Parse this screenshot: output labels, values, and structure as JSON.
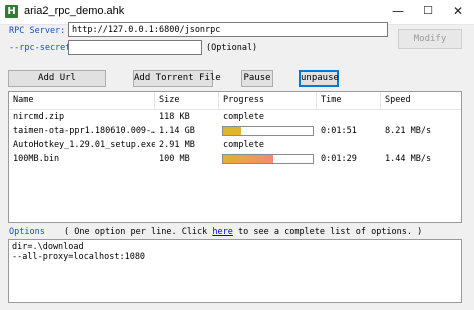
{
  "window": {
    "title": "aria2_rpc_demo.ahk",
    "icon_letter": "H",
    "minimize": "—",
    "maximize": "☐",
    "close": "✕"
  },
  "rpc": {
    "server_label": "RPC Server:",
    "server_value": "http://127.0.0.1:6800/jsonrpc",
    "secret_label": "--rpc-secret=",
    "secret_value": "",
    "optional_label": "(Optional)",
    "modify_label": "Modify"
  },
  "toolbar": {
    "add_url": "Add Url",
    "add_torrent": "Add Torrent File",
    "pause": "Pause",
    "unpause": "unpause"
  },
  "list": {
    "columns": [
      "Name",
      "Size",
      "Progress",
      "Time",
      "Speed"
    ],
    "rows": [
      {
        "name": "nircmd.zip",
        "size": "118 KB",
        "progress_text": "complete",
        "progress": null,
        "time": "",
        "speed": ""
      },
      {
        "name": "taimen-ota-ppr1.180610.009-…",
        "size": "1.14 GB",
        "progress_text": "",
        "progress": 0.2,
        "time": "0:01:51",
        "speed": "8.21 MB/s"
      },
      {
        "name": "AutoHotkey_1.29.01_setup.exe",
        "size": "2.91 MB",
        "progress_text": "complete",
        "progress": null,
        "time": "",
        "speed": ""
      },
      {
        "name": "100MB.bin",
        "size": "100 MB",
        "progress_text": "",
        "progress": 0.55,
        "time": "0:01:29",
        "speed": "1.44 MB/s"
      }
    ]
  },
  "options": {
    "label": "Options",
    "hint_before": "( One option per line. Click",
    "hint_link": "here",
    "hint_after": "to see a complete list of options. )",
    "lines": [
      "dir=.\\download",
      "--all-proxy=localhost:1080"
    ]
  },
  "colors": {
    "progress_fill_1": "#e0b430",
    "progress_fill_2_start": "#e0b430",
    "progress_fill_2_end": "#f08a78",
    "label_blue": "#1a4fb4",
    "focus": "#0078d7"
  }
}
